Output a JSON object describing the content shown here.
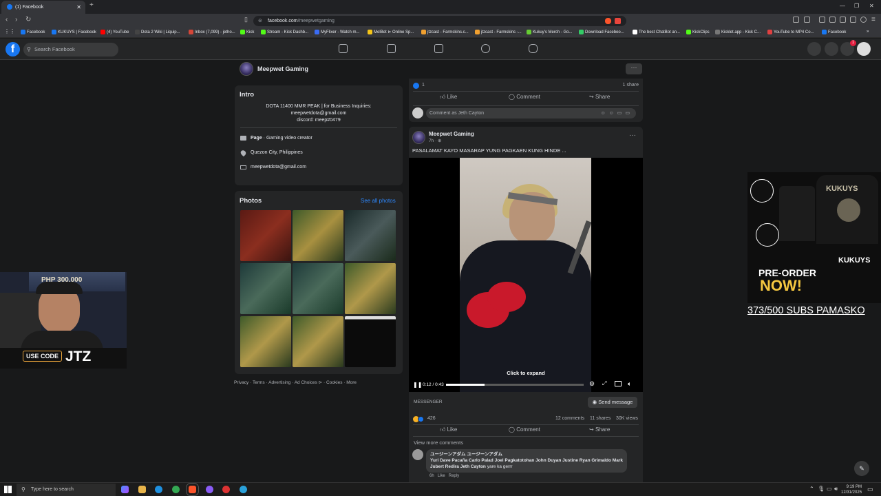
{
  "browser": {
    "tab_title": "(1) Facebook",
    "url_domain": "facebook.com",
    "url_path": "/meepwetgaming",
    "bookmarks": [
      "Facebook",
      "KUKUYS | Facebook",
      "(4) YouTube",
      "Dota 2 Wiki | Liquip...",
      "Inbox (7,099) - jetho...",
      "Kick",
      "Stream - Kick Dashb...",
      "MyFlixer - Watch m...",
      "MelBet ⊳ Online Sp...",
      "jtzcast - Farmskins.c...",
      "jtzcast - Farmskins -...",
      "Kukuy's Merch - Go...",
      "Download Faceboo...",
      "The best ChatBot an...",
      "KickClips",
      "Kicklet.app - Kick C...",
      "YouTube to MP4 Co...",
      "Facebook"
    ]
  },
  "fb": {
    "search_placeholder": "Search Facebook",
    "notification_count": "1",
    "colors": {
      "brand": "#1877f2",
      "background": "#18191a",
      "card": "#242526"
    }
  },
  "page": {
    "name": "Meepwet Gaming",
    "intro": {
      "heading": "Intro",
      "bio_line1": "DOTA 11400 MMR PEAK | for Business Inquiries:",
      "bio_line2": "meepwetdota@gmail.com",
      "bio_line3": "discord: meep#0479",
      "category_bold": "Page",
      "category_rest": " · Gaming video creator",
      "location": "Quezon City, Philippines",
      "email": "meepwetdota@gmail.com"
    },
    "photos": {
      "heading": "Photos",
      "see_all": "See all photos"
    },
    "footer": [
      "Privacy",
      "Terms",
      "Advertising",
      "Ad Choices ⊳",
      "Cookies",
      "More"
    ]
  },
  "prev_post": {
    "reactions": "1",
    "shares": "1 share",
    "like": "Like",
    "comment": "Comment",
    "share": "Share",
    "comment_placeholder": "Comment as Jeth Cayton"
  },
  "post": {
    "author": "Meepwet Gaming",
    "time": "7h · ",
    "caption": "PASALAMAT KAYO MASARAP YUNG PAGKAEN KUNG HINDE ...",
    "video": {
      "elapsed": "0:12 / 0:43",
      "progress": 0.28,
      "expand_hint": "Click to expand"
    },
    "messenger_label": "MESSENGER",
    "send_message": "Send message",
    "reactions": "426",
    "comments_count": "12 comments",
    "shares_count": "11 shares",
    "views": "30K views",
    "like": "Like",
    "comment": "Comment",
    "share": "Share",
    "view_more": "View more comments",
    "top_comment": {
      "author": "ユージーンアダム ユージーンアダム",
      "tags": "Yuri Dave Pacaña Carlo Palad Joel Pagkatotohan John Duyan Justine Ryan Grimaldo Mark Jubert Redira Jeth Cayton",
      "rest": " yare ka gerrr",
      "time": "6h",
      "like": "Like",
      "reply": "Reply"
    }
  },
  "overlay": {
    "use_code_label": "USE CODE",
    "code": "JTZ",
    "cam_sign": "PHP 300,000",
    "ad_brand": "KUKUYS",
    "ad_preorder": "PRE-ORDER",
    "ad_now": "NOW!",
    "subs_text": "373/500 SUBS PAMASKO"
  },
  "taskbar": {
    "search_placeholder": "Type here to search",
    "time": "9:19 PM",
    "date": "12/31/2025"
  }
}
